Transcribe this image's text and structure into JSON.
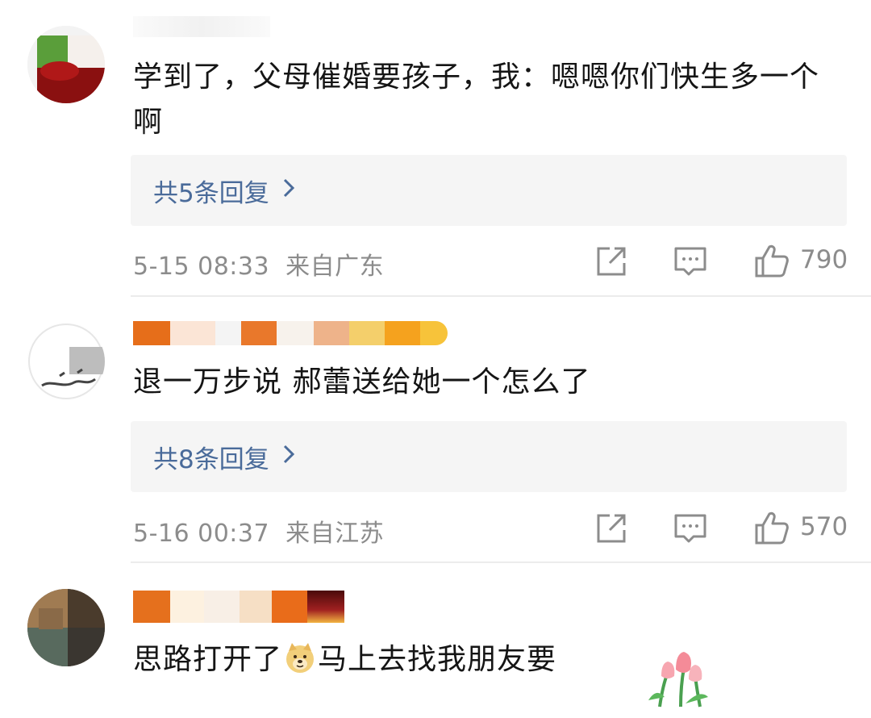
{
  "comments": [
    {
      "text": "学到了，父母催婚要孩子，我：嗯嗯你们快生多一个啊",
      "replies_label": "共5条回复",
      "time": "5-15 08:33",
      "location": "来自广东",
      "likes": "790"
    },
    {
      "text": "退一万步说 郝蕾送给她一个怎么了",
      "replies_label": "共8条回复",
      "time": "5-16 00:37",
      "location": "来自江苏",
      "likes": "570"
    },
    {
      "text_before": "思路打开了",
      "text_after": "马上去找我朋友要"
    }
  ],
  "icons": {
    "share": "share-icon",
    "comment": "comment-icon",
    "like": "thumbs-up-icon",
    "chevron": "chevron-right-icon",
    "emoji": "doge-emoji-icon",
    "sticker": "tulip-sticker-icon"
  },
  "colors": {
    "link": "#4a6b9a",
    "meta": "#8c8c8c",
    "reply_bg": "#f5f5f5"
  }
}
